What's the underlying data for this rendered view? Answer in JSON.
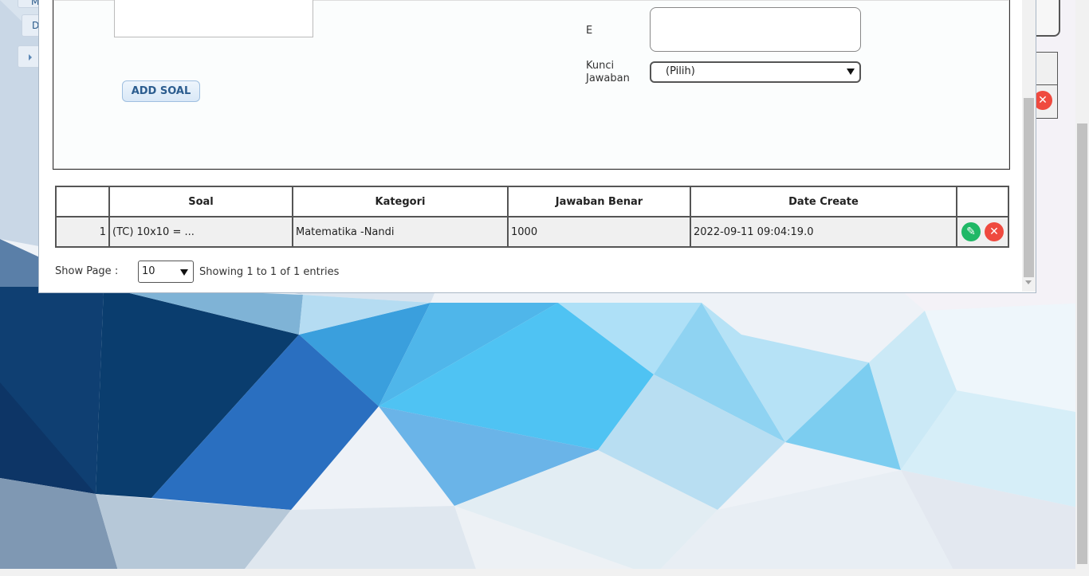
{
  "left_tabs": [
    "M",
    "D"
  ],
  "form": {
    "add_button": "ADD SOAL",
    "e_label": "E",
    "kunci_label_1": "Kunci",
    "kunci_label_2": "Jawaban",
    "kunci_select_value": "(Pilih)"
  },
  "table": {
    "headers": [
      "",
      "Soal",
      "Kategori",
      "Jawaban Benar",
      "Date Create",
      ""
    ],
    "rows": [
      {
        "no": "1",
        "soal": "(TC) 10x10 = ...",
        "kategori": "Matematika -Nandi",
        "jawaban": "1000",
        "date": "2022-09-11 09:04:19.0"
      }
    ]
  },
  "pager": {
    "label": "Show Page :",
    "value": "10",
    "info": "Showing 1 to 1 of 1 entries"
  },
  "icons": {
    "edit": "pencil-icon",
    "delete": "close-icon",
    "edit_color": "#1fb866",
    "delete_color": "#ef4a3f"
  }
}
